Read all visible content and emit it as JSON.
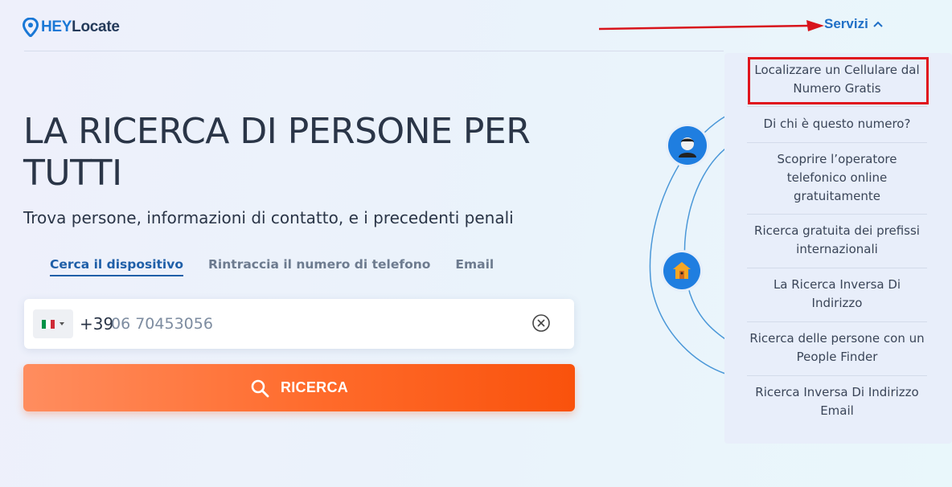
{
  "header": {
    "logo_hey": "HEY",
    "logo_locate": "Locate",
    "services_label": "Servizi"
  },
  "hero": {
    "title": "LA RICERCA DI PERSONE PER TUTTI",
    "subtitle": "Trova persone, informazioni di contatto, e i precedenti penali"
  },
  "tabs": [
    {
      "label": "Cerca il dispositivo",
      "active": true
    },
    {
      "label": "Rintraccia il numero di telefono",
      "active": false
    },
    {
      "label": "Email",
      "active": false
    }
  ],
  "search": {
    "country_prefix": "+39",
    "phone_value": "06 70453056",
    "button_label": "RICERCA"
  },
  "dropdown": {
    "items": [
      "Localizzare un Cellulare dal Numero Gratis",
      "Di chi è questo numero?",
      "Scoprire l’operatore telefonico online gratuitamente",
      "Ricerca gratuita dei prefissi internazionali",
      "La Ricerca Inversa Di Indirizzo",
      "Ricerca delle persone con un People Finder",
      "Ricerca Inversa Di Indirizzo Email"
    ]
  },
  "colors": {
    "brand_blue": "#1f6fc6",
    "button_orange": "#ff6a2a",
    "highlight_red": "#e0141c"
  },
  "icons": [
    "location-pin-icon",
    "chevron-up-icon",
    "italy-flag-icon",
    "clear-circle-icon",
    "search-icon",
    "person-icon",
    "house-icon"
  ]
}
